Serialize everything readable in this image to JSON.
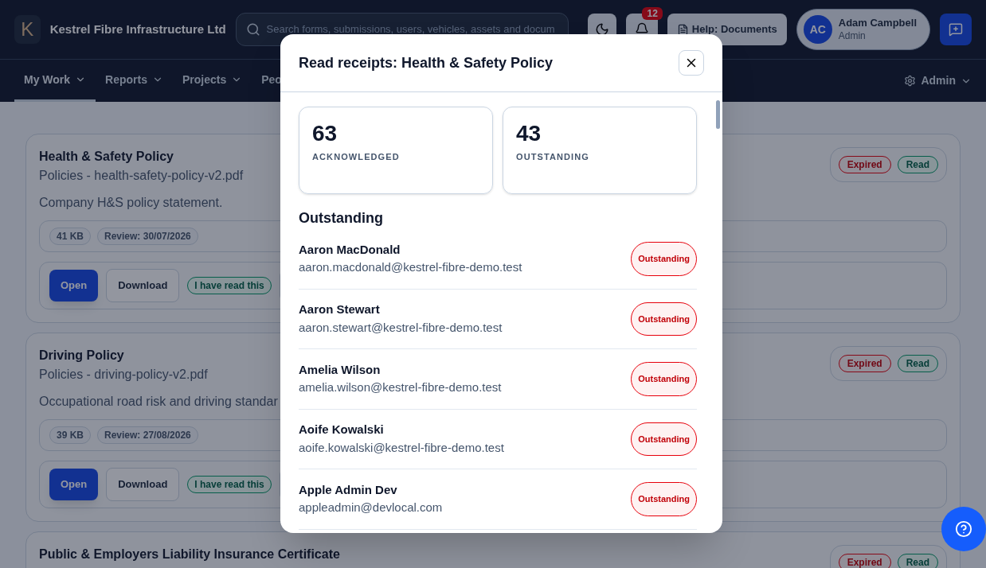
{
  "header": {
    "logo_letter": "K",
    "company": "Kestrel Fibre Infrastructure Ltd",
    "search": {
      "placeholder": "Search forms, submissions, users, vehicles, assets and docum"
    },
    "notifications": {
      "count": "12"
    },
    "help_button": "Help: Documents",
    "user": {
      "initials": "AC",
      "name": "Adam Campbell",
      "role": "Admin"
    }
  },
  "nav": {
    "items": [
      {
        "label": "My Work",
        "selected": true,
        "caret": true
      },
      {
        "label": "Reports",
        "selected": false,
        "caret": true
      },
      {
        "label": "Projects",
        "selected": false,
        "caret": true
      },
      {
        "label": "Peo",
        "selected": false,
        "caret": false
      }
    ],
    "admin": "Admin"
  },
  "documents": [
    {
      "title": "Health & Safety Policy",
      "subtitle": "Policies - health-safety-policy-v2.pdf",
      "description": "Company H&S policy statement.",
      "tags": [
        "41 KB",
        "Review: 30/07/2026"
      ],
      "actions": [
        "Open",
        "Download",
        "I have read this"
      ],
      "badges": [
        {
          "label": "Expired",
          "kind": "danger"
        },
        {
          "label": "Read",
          "kind": "success"
        }
      ]
    },
    {
      "title": "Driving Policy",
      "subtitle": "Policies - driving-policy-v2.pdf",
      "description": "Occupational road risk and driving standar",
      "tags": [
        "39 KB",
        "Review: 27/08/2026"
      ],
      "actions": [
        "Open",
        "Download",
        "I have read this"
      ],
      "badges": [
        {
          "label": "Expired",
          "kind": "danger"
        },
        {
          "label": "Read",
          "kind": "success"
        }
      ]
    },
    {
      "title": "Public & Employers Liability Insurance Certificate",
      "badges": [
        {
          "label": "Expired",
          "kind": "danger"
        },
        {
          "label": "Read",
          "kind": "success"
        }
      ]
    }
  ],
  "modal": {
    "title": "Read receipts: Health & Safety Policy",
    "stats": [
      {
        "value": "63",
        "label": "ACKNOWLEDGED"
      },
      {
        "value": "43",
        "label": "OUTSTANDING"
      }
    ],
    "section": "Outstanding",
    "people": [
      {
        "name": "Aaron MacDonald",
        "email": "aaron.macdonald@kestrel-fibre-demo.test",
        "status": "Outstanding"
      },
      {
        "name": "Aaron Stewart",
        "email": "aaron.stewart@kestrel-fibre-demo.test",
        "status": "Outstanding"
      },
      {
        "name": "Amelia Wilson",
        "email": "amelia.wilson@kestrel-fibre-demo.test",
        "status": "Outstanding"
      },
      {
        "name": "Aoife Kowalski",
        "email": "aoife.kowalski@kestrel-fibre-demo.test",
        "status": "Outstanding"
      },
      {
        "name": "Apple Admin Dev",
        "email": "appleadmin@devlocal.com",
        "status": "Outstanding"
      }
    ]
  }
}
